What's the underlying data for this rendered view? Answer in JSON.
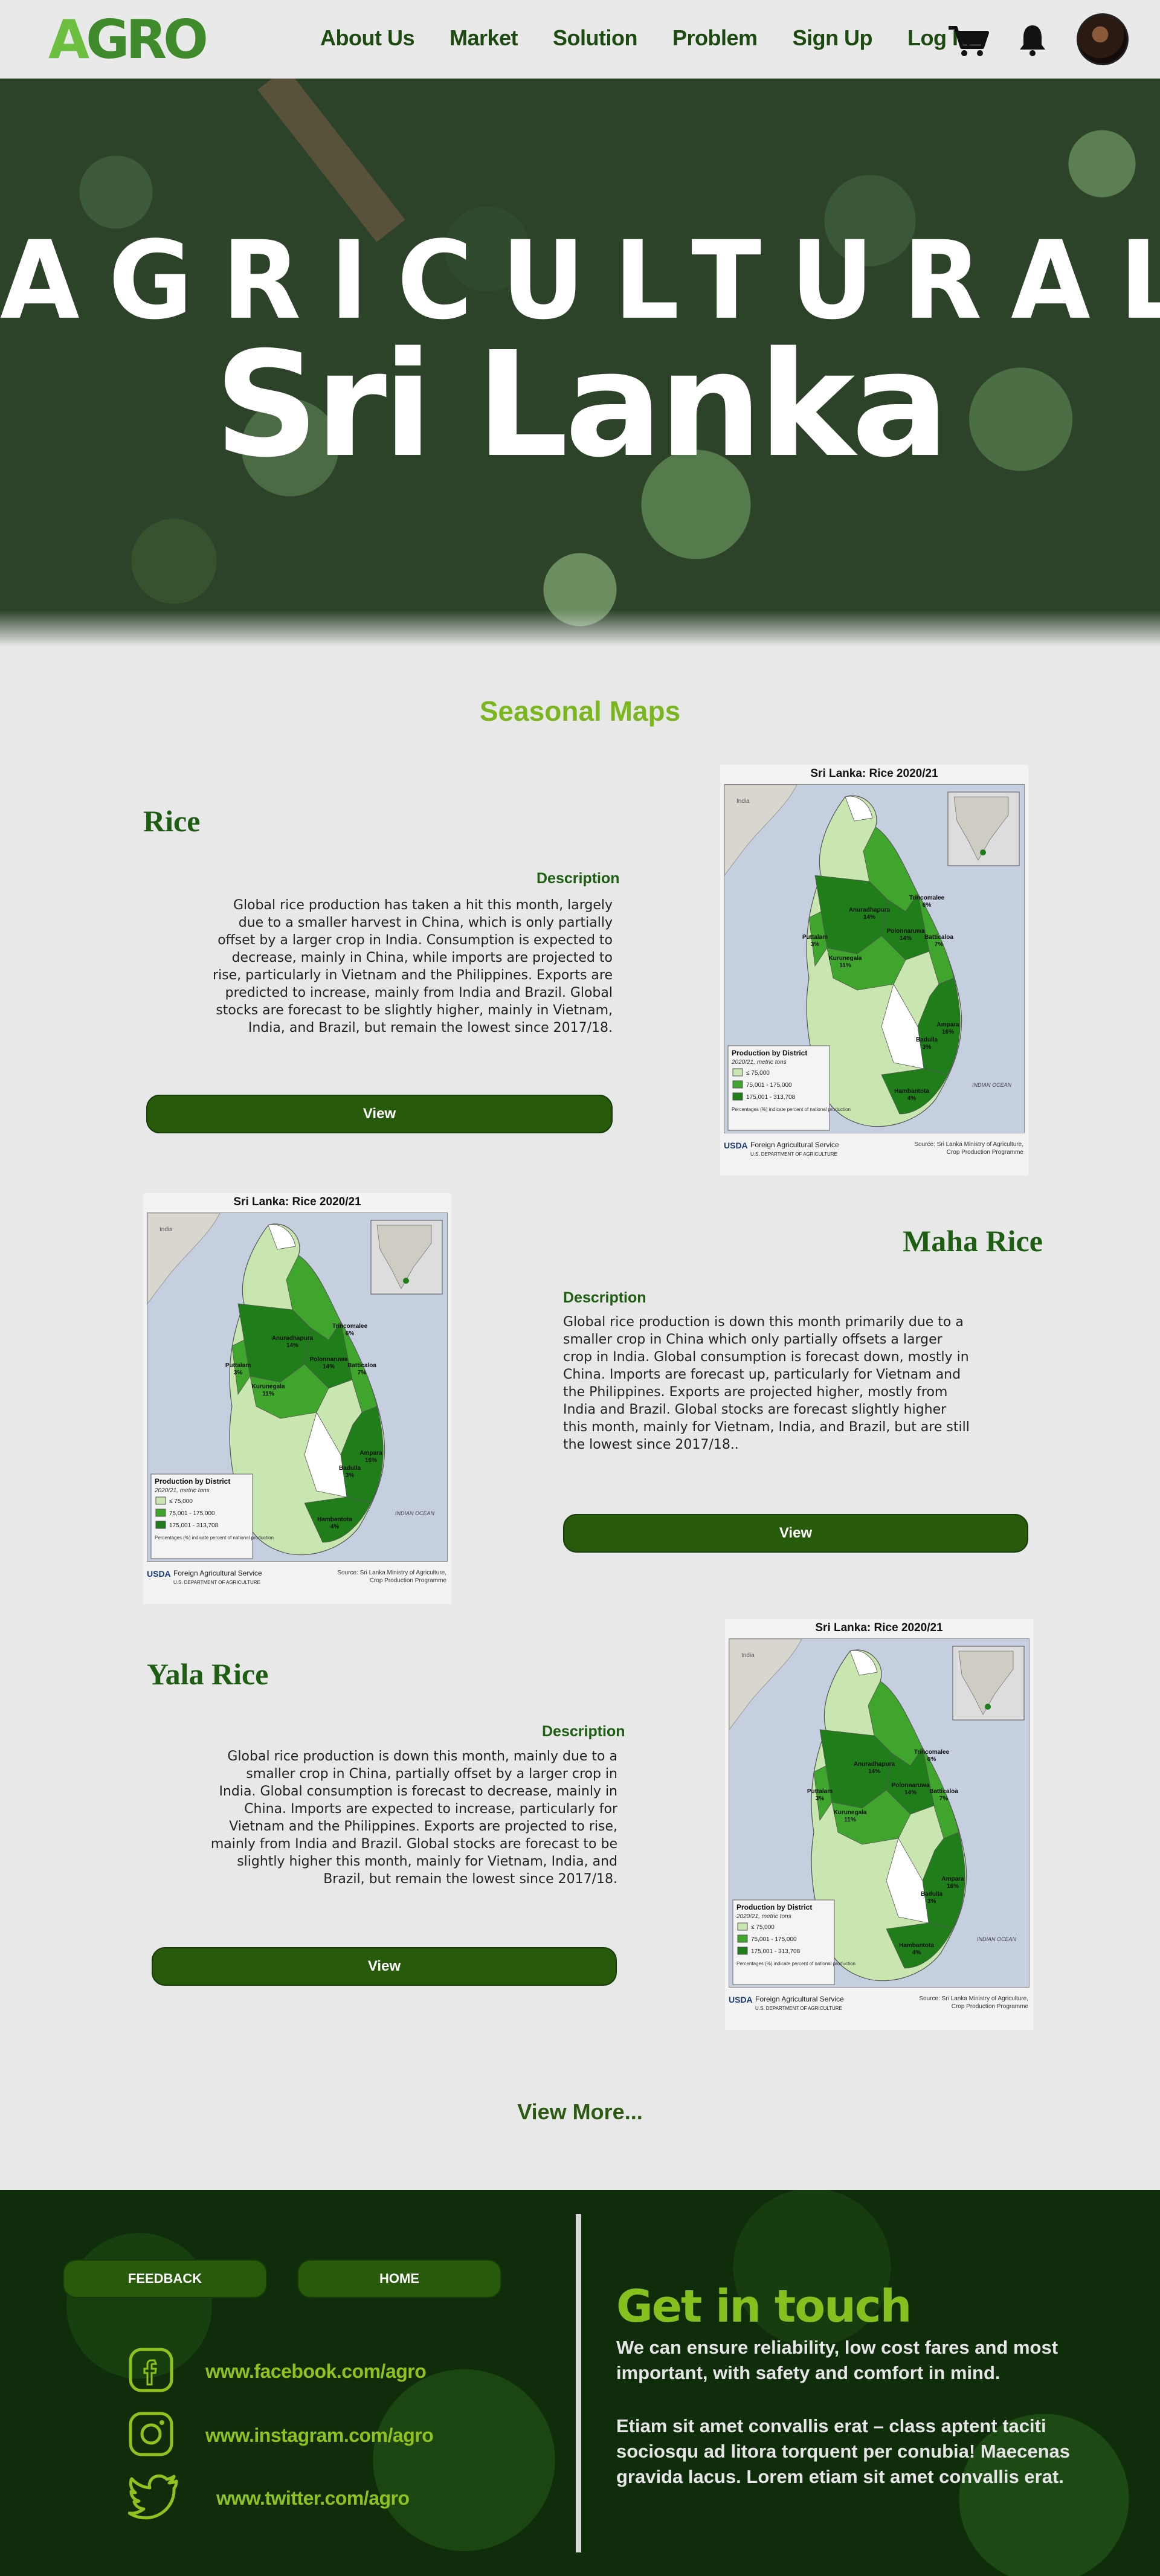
{
  "nav": {
    "logo_a": "A",
    "logo_rest": "GRO",
    "links": [
      "About Us",
      "Market",
      "Solution",
      "Problem",
      "Sign Up",
      "Log In"
    ],
    "icons": [
      "cart-icon",
      "bell-icon"
    ]
  },
  "hero": {
    "title_line1": "AGRICULTURAL",
    "title_line2": "Sri Lanka"
  },
  "section_title": "Seasonal Maps",
  "map": {
    "title": "Sri Lanka: Rice 2020/21",
    "legend_title": "Production by District",
    "legend_sub": "2020/21, metric tons",
    "legend_items": [
      "≤ 75,000",
      "75,001 - 175,000",
      "175,001 - 313,708"
    ],
    "legend_note": "Percentages (%) indicate percent of national production",
    "ocean_label": "INDIAN OCEAN",
    "india_label": "India",
    "usda_logo": "USDA",
    "agency": "Foreign Agricultural Service",
    "agency_sub": "U.S. DEPARTMENT OF AGRICULTURE",
    "source": "Source: Sri Lanka Ministry of Agriculture, Crop Production Programme",
    "districts": [
      {
        "name": "Anuradhapura",
        "pct": "14%"
      },
      {
        "name": "Trincomalee",
        "pct": "6%"
      },
      {
        "name": "Polonnaruwa",
        "pct": "14%"
      },
      {
        "name": "Batticaloa",
        "pct": "7%"
      },
      {
        "name": "Puttalam",
        "pct": "3%"
      },
      {
        "name": "Kurunegala",
        "pct": "11%"
      },
      {
        "name": "Ampara",
        "pct": "16%"
      },
      {
        "name": "Badulla",
        "pct": "3%"
      },
      {
        "name": "Hambantota",
        "pct": "4%"
      }
    ]
  },
  "cards": [
    {
      "title": "Rice",
      "desc_label": "Description",
      "body": "Global rice production has taken a hit this month, largely due to a smaller harvest in China, which is only partially offset by a larger crop in India. Consumption is expected to decrease, mainly in China, while imports are projected to rise, particularly in Vietnam and the Philippines. Exports are predicted to increase, mainly from India and Brazil. Global stocks are forecast to be slightly higher, mainly in Vietnam, India, and Brazil, but remain the lowest since 2017/18.",
      "button": "View"
    },
    {
      "title": "Maha Rice",
      "desc_label": "Description",
      "body": "Global rice production is down this month primarily due to a smaller crop in China which only partially offsets a larger crop in India. Global consumption is forecast down, mostly in China. Imports are forecast up, particularly for Vietnam and the Philippines. Exports are projected higher, mostly from India and Brazil. Global stocks are forecast slightly higher this month, mainly for Vietnam, India, and Brazil, but are still the lowest since 2017/18..",
      "button": "View"
    },
    {
      "title": "Yala Rice",
      "desc_label": "Description",
      "body": "Global rice production is down this month, mainly due to a smaller crop in China, partially offset by a larger crop in India. Global consumption is forecast to decrease, mainly in China. Imports are expected to increase, particularly for Vietnam and the Philippines. Exports are projected to rise, mainly from India and Brazil. Global stocks are forecast to be slightly higher this month, mainly for Vietnam, India, and Brazil, but remain the lowest since 2017/18.",
      "button": "View"
    }
  ],
  "view_more": "View More...",
  "footer": {
    "feedback": "FEEDBACK",
    "home": "HOME",
    "socials": [
      {
        "icon": "facebook-icon",
        "text": "www.facebook.com/agro"
      },
      {
        "icon": "instagram-icon",
        "text": "www.instagram.com/agro"
      },
      {
        "icon": "twitter-icon",
        "text": "www.twitter.com/agro"
      }
    ],
    "get_in_touch": "Get in touch",
    "tagline": "We can ensure reliability, low cost fares and most important, with safety and comfort in mind.",
    "lorem": "Etiam sit amet convallis erat – class aptent taciti sociosqu ad litora torquent per conubia! Maecenas gravida lacus. Lorem etiam sit amet convallis erat.",
    "colors": {
      "accent": "#86c01e",
      "button": "#275a0b",
      "footer_bg": "#0f2d0b"
    }
  }
}
